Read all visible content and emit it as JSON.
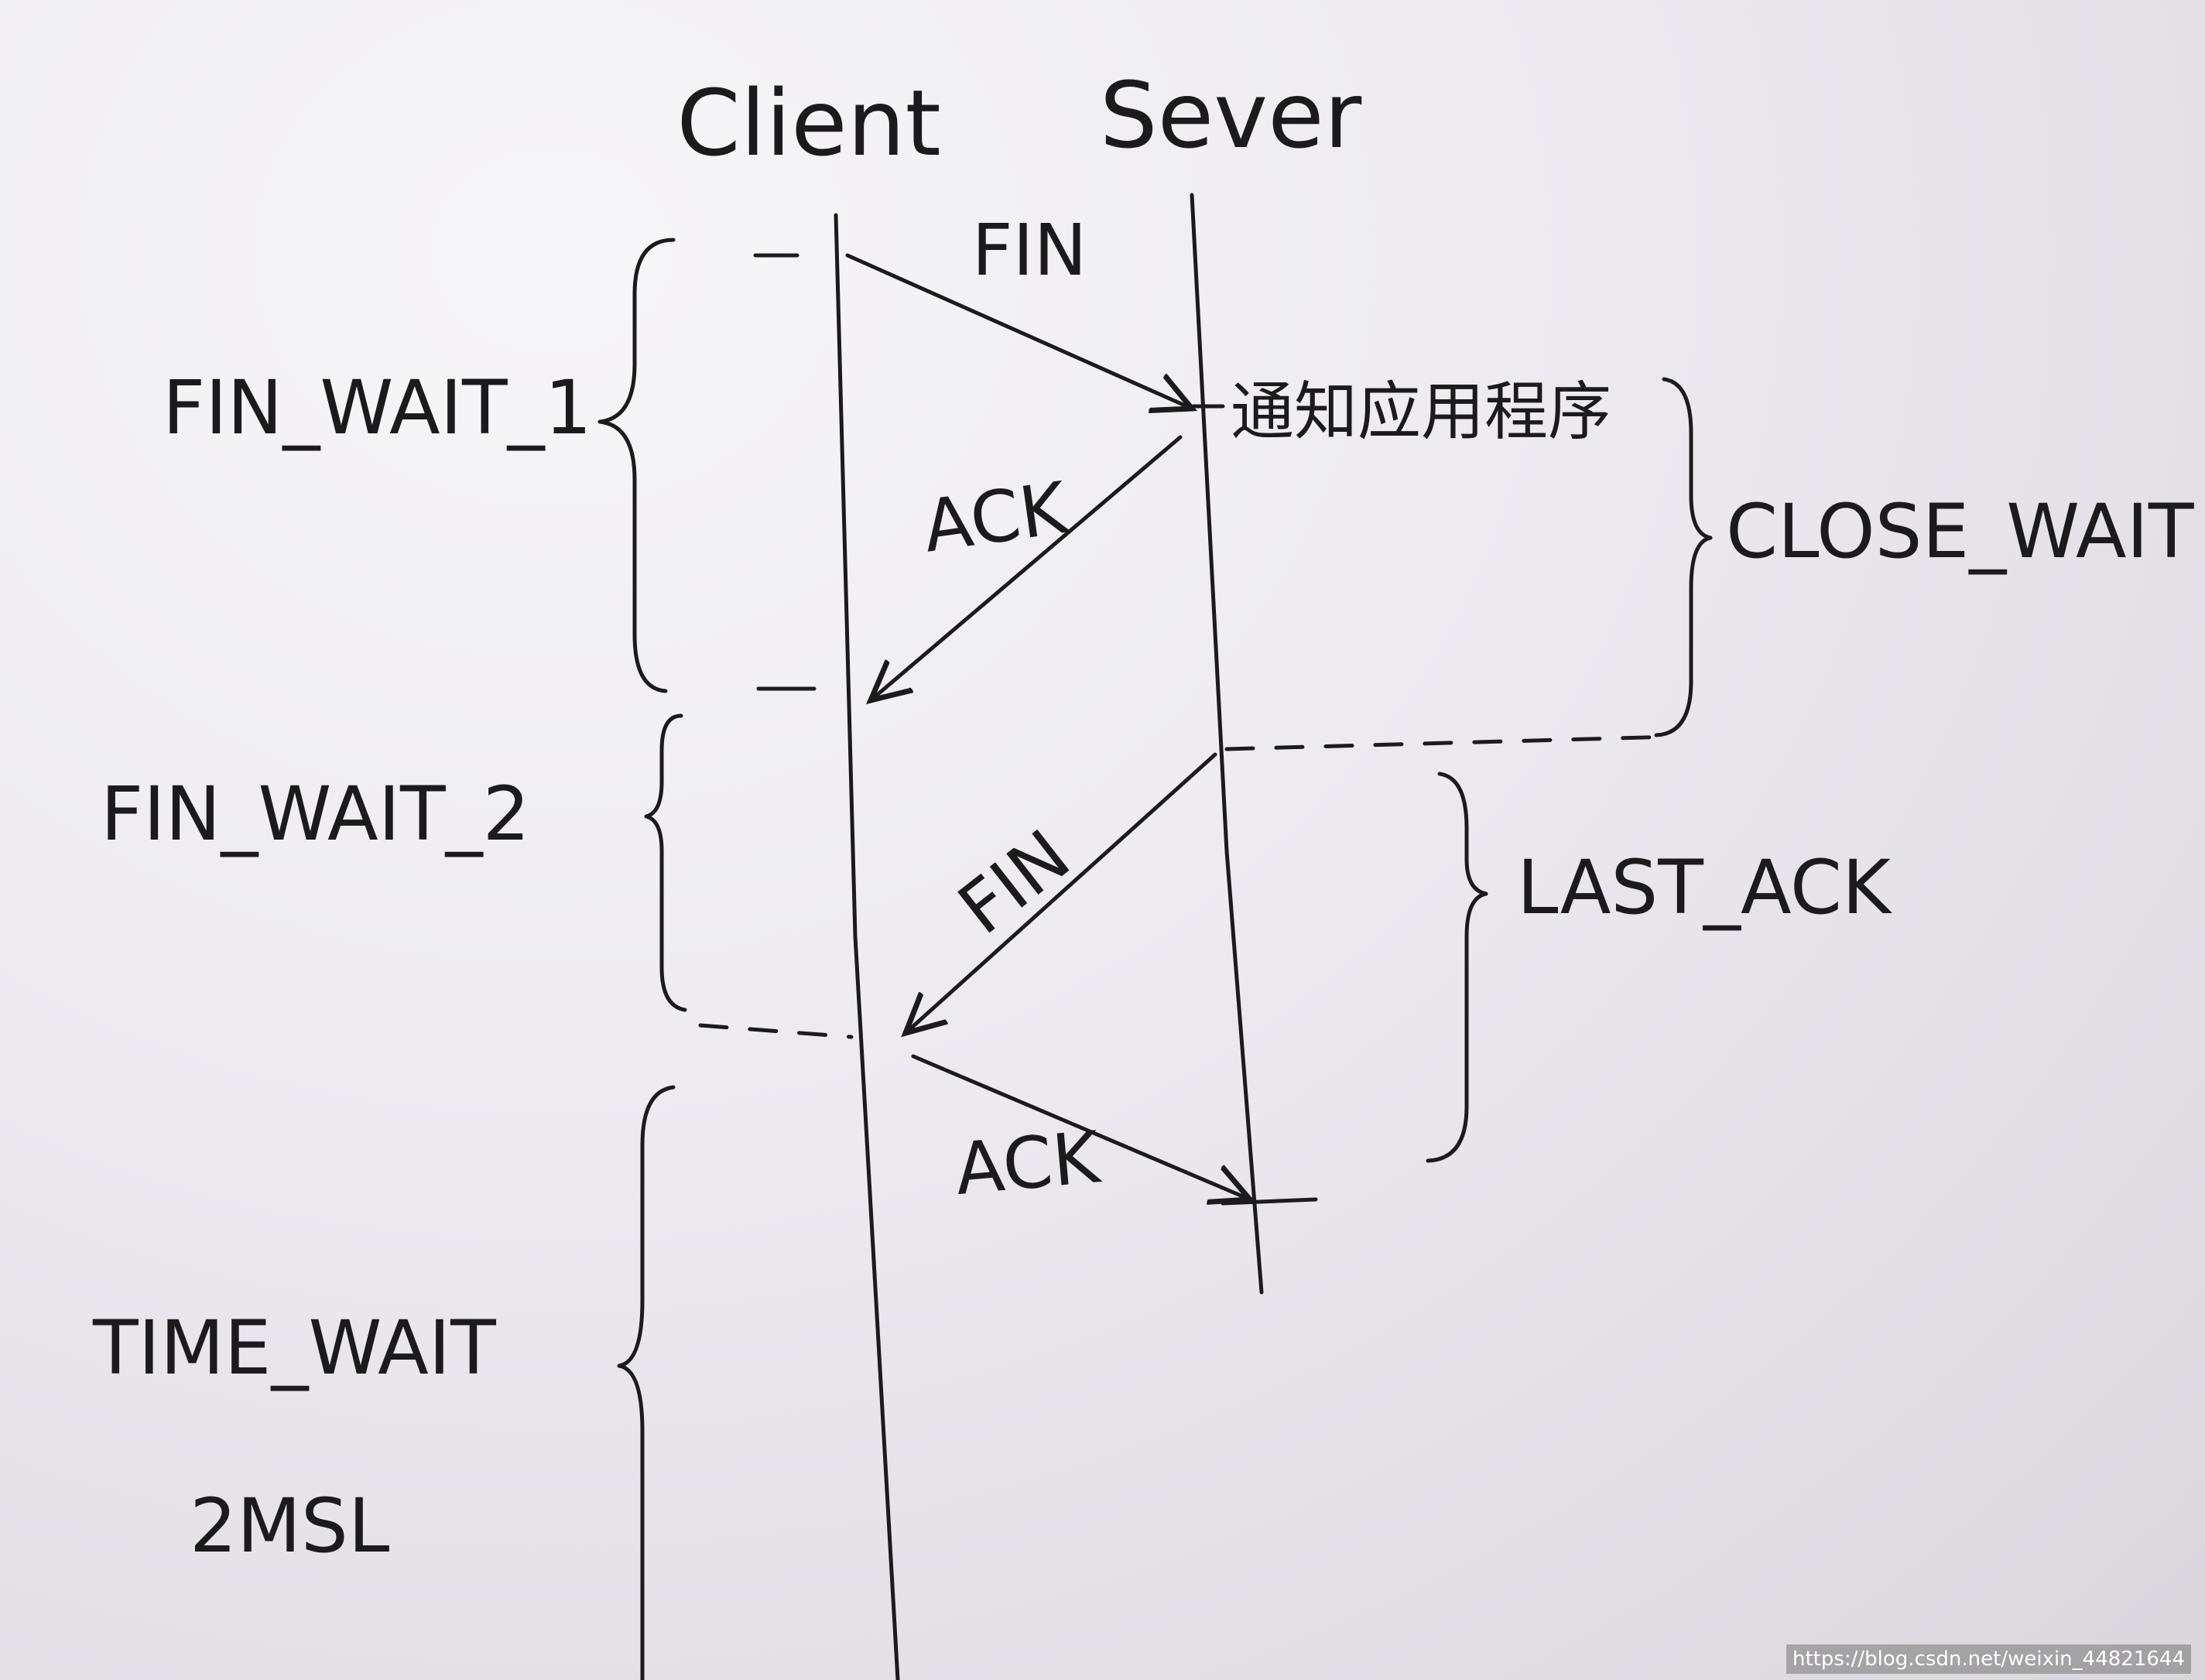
{
  "participants": {
    "client": "Client",
    "server": "Sever"
  },
  "messages": {
    "fin_1": "FIN",
    "ack_1": "ACK",
    "fin_2": "FIN",
    "ack_2": "ACK"
  },
  "server_note": "通知应用程序",
  "client_states": {
    "fin_wait_1": "FIN_WAIT_1",
    "fin_wait_2": "FIN_WAIT_2",
    "time_wait": "TIME_WAIT",
    "time_wait_duration": "2MSL"
  },
  "server_states": {
    "close_wait": "CLOSE_WAIT",
    "last_ack": "LAST_ACK"
  },
  "watermark": "https://blog.csdn.net/weixin_44821644",
  "colors": {
    "ink": "#1b1b1d",
    "paper": "#eceaef"
  }
}
